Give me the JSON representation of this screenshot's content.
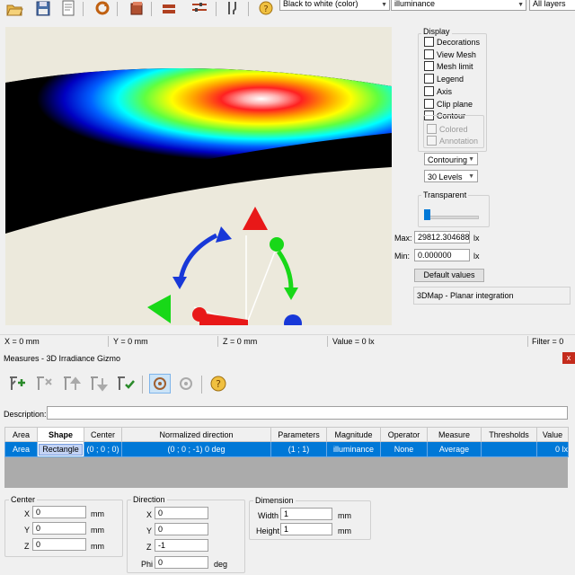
{
  "toolbar": {
    "colormap_select": "Black to white (color)",
    "quantity_select": "illuminance",
    "layers_select": "All layers"
  },
  "display": {
    "title": "Display",
    "checkboxes": [
      {
        "label": "Decorations",
        "checked": false
      },
      {
        "label": "View Mesh",
        "checked": false
      },
      {
        "label": "Mesh limit",
        "checked": false
      },
      {
        "label": "Legend",
        "checked": false
      },
      {
        "label": "Axis",
        "checked": false
      },
      {
        "label": "Clip plane",
        "checked": false
      },
      {
        "label": "Contour",
        "checked": false
      }
    ],
    "contour_sub": [
      {
        "label": "Colored",
        "enabled": false
      },
      {
        "label": "Annotation",
        "enabled": false
      }
    ],
    "contouring_select": "Contouring",
    "levels_select": "30 Levels",
    "transparent_label": "Transparent",
    "transparency": 0.0,
    "max_label": "Max:",
    "max_value": "29812.304688",
    "max_unit": "lx",
    "min_label": "Min:",
    "min_value": "0.000000",
    "min_unit": "lx",
    "default_values_button": "Default values",
    "map_info": "3DMap - Planar integration"
  },
  "status": {
    "x": "X = 0 mm",
    "y": "Y = 0 mm",
    "z": "Z = 0 mm",
    "value": "Value = 0 lx",
    "filter": "Filter = 0"
  },
  "measures": {
    "title": "Measures - 3D Irradiance Gizmo",
    "close": "x",
    "description_label": "Description:",
    "description_value": "",
    "columns": [
      "Area",
      "Shape",
      "Center",
      "Normalized direction",
      "Parameters",
      "Magnitude",
      "Operator",
      "Measure",
      "Thresholds",
      "Value"
    ],
    "rows": [
      [
        "Area",
        "Rectangle",
        "(0 ; 0 ; 0)",
        "(0 ; 0 ; -1) 0 deg",
        "(1 ; 1)",
        "illuminance",
        "None",
        "Average",
        "",
        "0 lx"
      ]
    ]
  },
  "center": {
    "title": "Center",
    "x_label": "X",
    "x": "0",
    "y_label": "Y",
    "y": "0",
    "z_label": "Z",
    "z": "0",
    "unit": "mm"
  },
  "direction": {
    "title": "Direction",
    "x_label": "X",
    "x": "0",
    "y_label": "Y",
    "y": "0",
    "z_label": "Z",
    "z": "-1",
    "phi_label": "Phi",
    "phi": "0",
    "phi_unit": "deg"
  },
  "dimension": {
    "title": "Dimension",
    "width_label": "Width",
    "width": "1",
    "height_label": "Height",
    "height": "1",
    "unit": "mm"
  },
  "colors": {
    "selection": "#0078d7",
    "close": "#c42b1c",
    "gizmo_red": "#e81818",
    "gizmo_green": "#18d818",
    "gizmo_blue": "#1838d8"
  }
}
